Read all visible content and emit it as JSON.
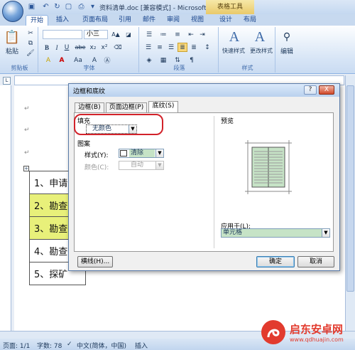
{
  "window": {
    "title": "资料清单.doc [兼容模式] - Microsoft ...",
    "context_tab_group": "表格工具"
  },
  "tabs": [
    "开始",
    "插入",
    "页面布局",
    "引用",
    "邮件",
    "审阅",
    "视图",
    "设计",
    "布局"
  ],
  "ribbon": {
    "clipboard": {
      "paste_label": "粘贴",
      "group_label": "剪贴板"
    },
    "font": {
      "size_value": "小三",
      "group_label": "字体",
      "bold": "B",
      "italic": "I",
      "underline": "U",
      "strike": "abe",
      "subscript": "x₂",
      "superscript": "x²",
      "font_color": "A",
      "change_case": "Aa",
      "highlight": "A"
    },
    "paragraph": {
      "group_label": "段落"
    },
    "styles": {
      "quick_styles": "快速样式",
      "change_styles": "更改样式",
      "group_label": "样式"
    },
    "editing": {
      "label": "编辑"
    }
  },
  "document": {
    "rows": [
      "1、申请",
      "2、勘查",
      "3、勘查",
      "4、勘查",
      "5、探矿"
    ],
    "highlight_color": "#e8f07a"
  },
  "dialog": {
    "title": "边框和底纹",
    "help": "?",
    "close": "X",
    "tabs": [
      "边框(B)",
      "页面边框(P)",
      "底纹(S)"
    ],
    "fill": {
      "label": "填充",
      "value": "无颜色"
    },
    "pattern": {
      "label": "图案",
      "style_label": "样式(Y):",
      "style_value": "清除",
      "color_label": "颜色(C):",
      "color_value": "自动"
    },
    "preview": {
      "label": "预览"
    },
    "apply_to": {
      "label": "应用于(L):",
      "value": "单元格"
    },
    "buttons": {
      "horizontal_line": "横线(H)...",
      "ok": "确定",
      "cancel": "取消"
    },
    "preview_fill_color": "#c6e3c6"
  },
  "status": {
    "page": "页面: 1/1",
    "words": "字数: 78",
    "language": "中文(简体，中国)",
    "mode": "插入"
  },
  "watermark": {
    "text": "启东安卓网",
    "url": "www.qdhuajin.com"
  }
}
